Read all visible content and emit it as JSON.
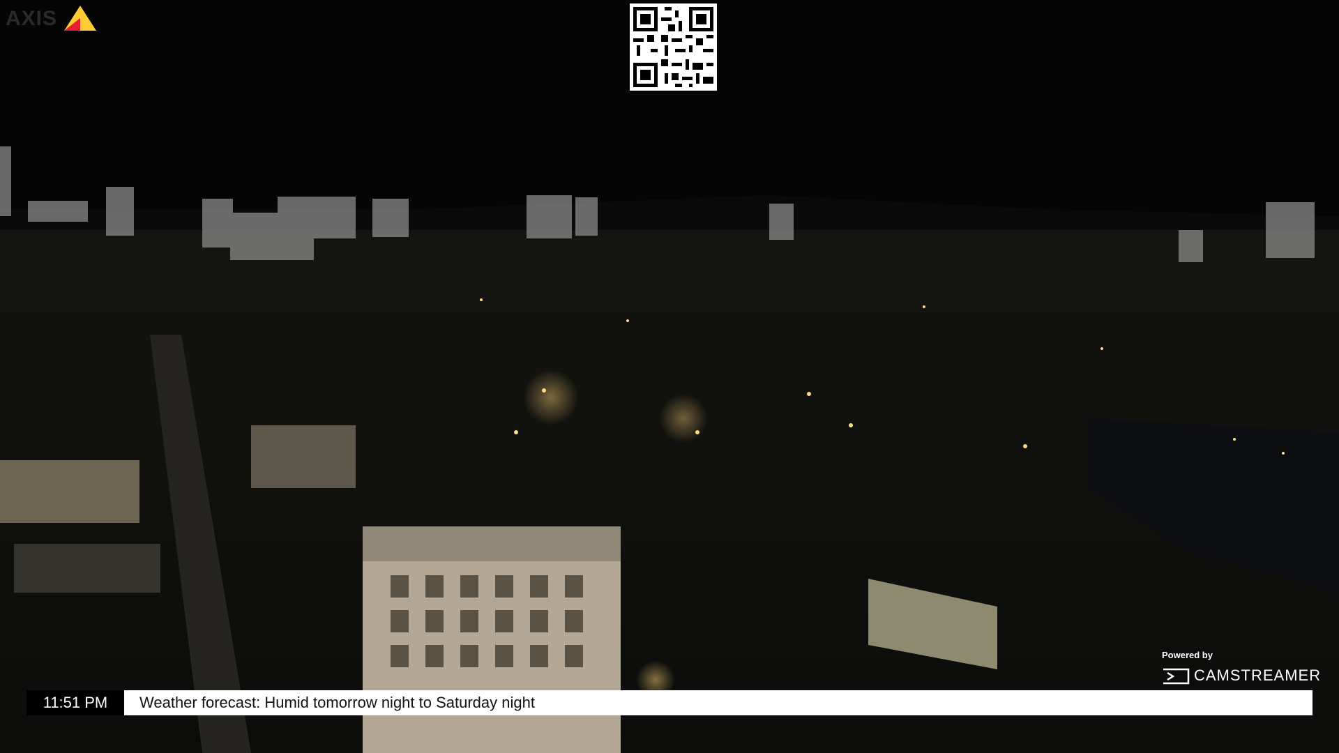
{
  "logo": {
    "text": "AXIS",
    "colors": {
      "red": "#e5202e",
      "yellow": "#ffcc33"
    }
  },
  "qr": {
    "icon": "qr-code-icon"
  },
  "powered": {
    "label": "Powered by",
    "brand": "CAMSTREAMER",
    "icon": "camstreamer-logo-icon"
  },
  "ticker": {
    "time": "11:51 PM",
    "message": "Weather forecast: Humid tomorrow night to Saturday night"
  },
  "colors": {
    "sky": "#050505",
    "ticker_bg": "#ffffff",
    "time_bg": "#000000"
  }
}
